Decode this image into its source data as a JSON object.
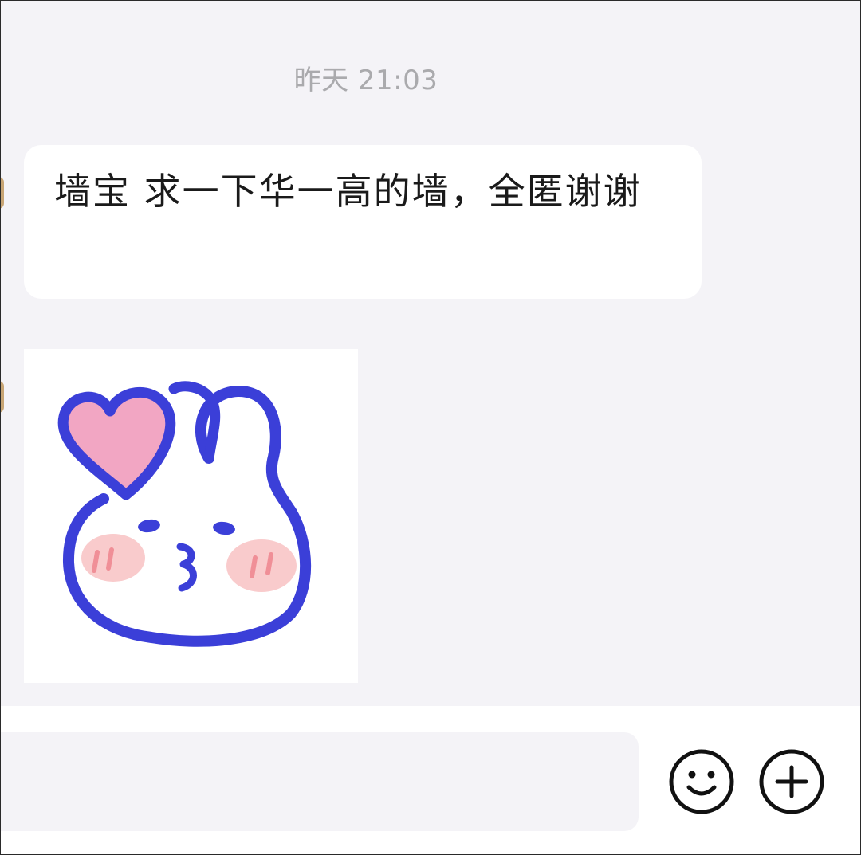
{
  "chat": {
    "timestamp": "昨天 21:03",
    "messages": [
      {
        "type": "text",
        "text": "墙宝 求一下华一高的墙，全匿谢谢"
      },
      {
        "type": "sticker",
        "sticker_icon": "bunny-heart-kiss-sticker"
      }
    ]
  },
  "input_bar": {
    "value": "",
    "placeholder": "",
    "emoji_icon": "smiley-icon",
    "plus_icon": "plus-circle-icon"
  },
  "colors": {
    "background": "#f4f3f7",
    "bubble": "#ffffff",
    "timestamp": "#aaaaad",
    "sticker_outline": "#3b3fd8",
    "sticker_heart": "#f2a6c3",
    "sticker_blush": "#f7b9bb"
  }
}
